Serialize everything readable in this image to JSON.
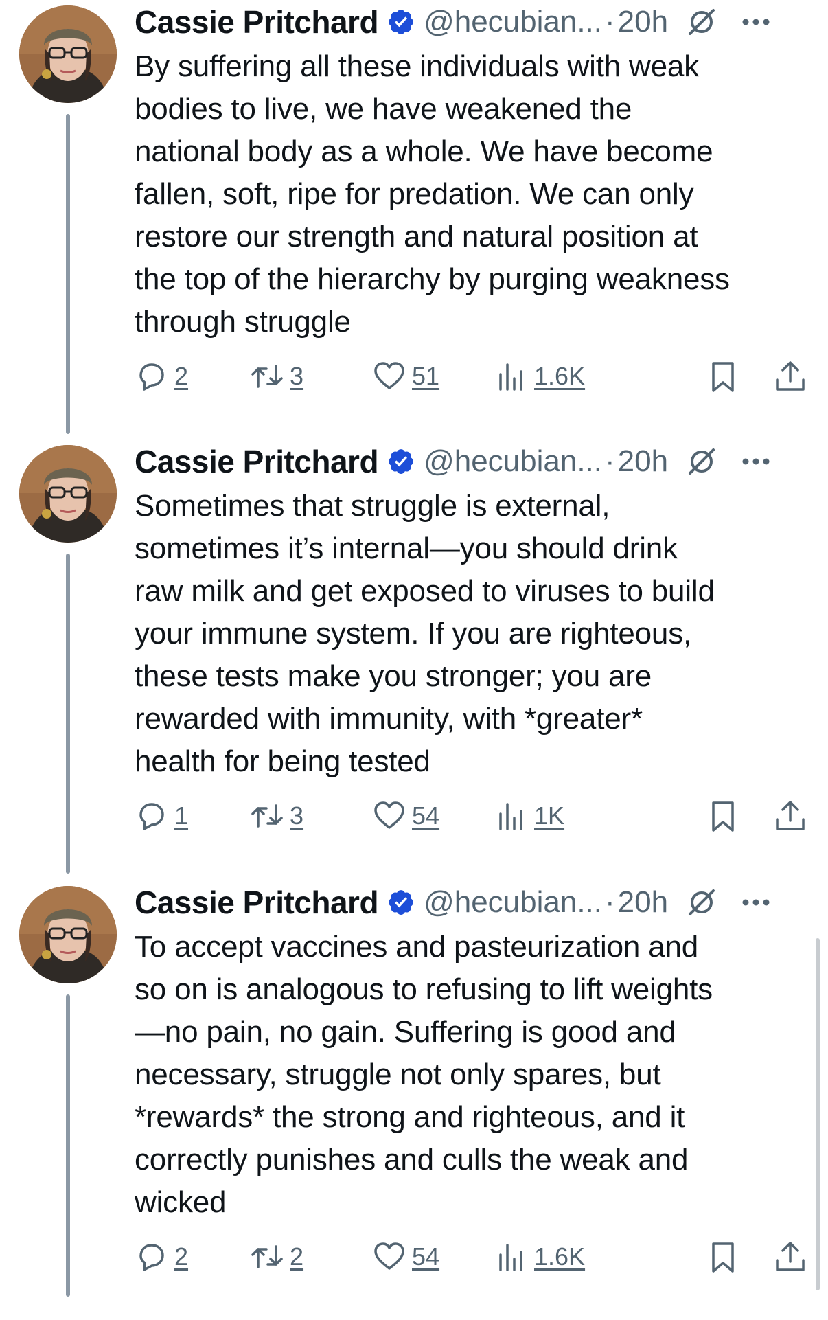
{
  "colors": {
    "text": "#0f1419",
    "secondary": "#536471",
    "verified": "#1d4ed8",
    "thread_line": "#8b98a5"
  },
  "tweets": [
    {
      "author": "Cassie Pritchard",
      "handle": "@hecubian...",
      "separator": "·",
      "time": "20h",
      "text": "By suffering all these individuals with weak\nbodies to live, we have weakened the\nnational body as a whole. We have become\nfallen, soft, ripe for predation. We can only\nrestore our strength and natural position at\nthe top of the hierarchy by purging weakness\nthrough struggle",
      "replies": "2",
      "reposts": "3",
      "likes": "51",
      "views": "1.6K"
    },
    {
      "author": "Cassie Pritchard",
      "handle": "@hecubian...",
      "separator": "·",
      "time": "20h",
      "text": "Sometimes that struggle is external,\nsometimes it’s internal—you should drink\nraw milk and get exposed to viruses to build\nyour immune system. If you are righteous,\nthese tests make you stronger; you are\nrewarded with immunity, with *greater*\nhealth for being tested",
      "replies": "1",
      "reposts": "3",
      "likes": "54",
      "views": "1K"
    },
    {
      "author": "Cassie Pritchard",
      "handle": "@hecubian...",
      "separator": "·",
      "time": "20h",
      "text": "To accept vaccines and pasteurization and\nso on is analogous to refusing to lift weights\n—no pain, no gain. Suffering is good and\nnecessary, struggle not only spares, but\n*rewards* the strong and righteous, and it\ncorrectly punishes and culls the weak and\nwicked",
      "replies": "2",
      "reposts": "2",
      "likes": "54",
      "views": "1.6K"
    }
  ],
  "icons": {
    "verified": "verified-badge-icon",
    "quiet": "mute-circle-slash-icon",
    "more": "more-dots-icon",
    "reply": "reply-bubble-icon",
    "repost": "repost-arrows-icon",
    "like": "heart-icon",
    "views": "views-bars-icon",
    "bookmark": "bookmark-icon",
    "share": "share-upload-icon"
  }
}
